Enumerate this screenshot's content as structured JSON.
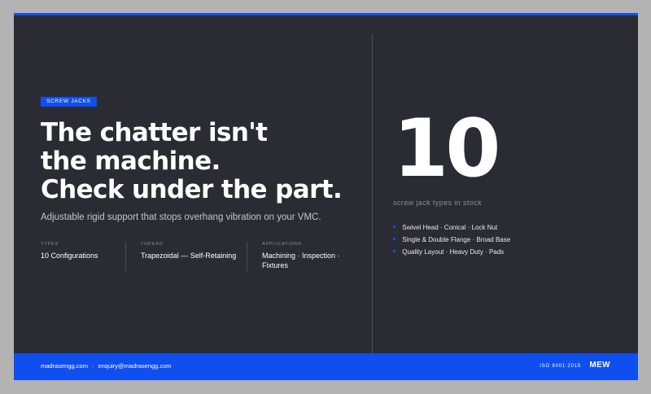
{
  "colors": {
    "page_background": "#b3b3b3",
    "slide_background": "#2b2c33",
    "accent": "#0f4ff0",
    "text_primary": "#ffffff",
    "text_muted": "#8b8c94"
  },
  "tag": {
    "label": "SCREW JACKS"
  },
  "headline": {
    "lines": [
      "The chatter isn't",
      "the machine.",
      "Check under the part."
    ]
  },
  "subline": "Adjustable rigid support that stops overhang vibration on your VMC.",
  "specs": [
    {
      "label": "TYPES",
      "value": "10 Configurations"
    },
    {
      "label": "THREAD",
      "value": "Trapezoidal — Self-Retaining"
    },
    {
      "label": "APPLICATIONS",
      "value": "Machining · Inspection · Fixtures"
    }
  ],
  "stat": {
    "number": "10",
    "caption": "screw jack types in stock"
  },
  "types": [
    "Swivel Head · Conical · Lock Nut",
    "Single & Double Flange · Broad Base",
    "Quality Layout · Heavy Duty · Pads"
  ],
  "footer": {
    "website": "madrasengg.com",
    "separator": "·",
    "email": "enquiry@madrasengg.com",
    "certification": "ISO 9001:2015",
    "brand": "MEW"
  },
  "icons": {
    "bullet": "diamond-bullet-icon"
  }
}
